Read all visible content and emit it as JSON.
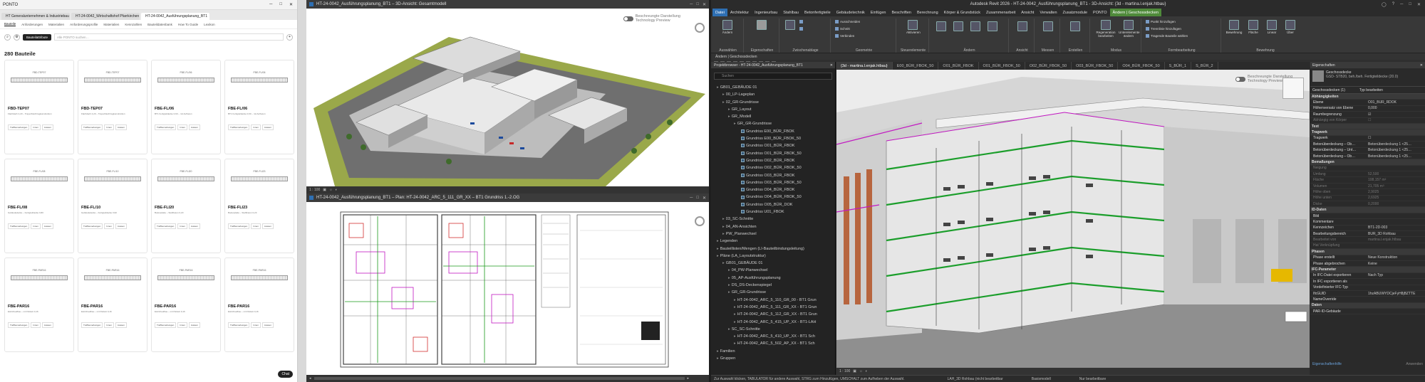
{
  "ponto": {
    "window_title": "PONTO",
    "tabs": [
      "HT Generalunternehmen & Industriebau",
      "HT-24-0042_Wirtschaftshof Pfarrkirchen",
      "HT-24-0042_Ausführungsplanung_BT1"
    ],
    "nav": [
      "Bauteile",
      "Anforderungen",
      "Materialien",
      "Anforderungsprofile",
      "Materialien",
      "Kennzahlen",
      "Bauteildatenbank",
      "How To Guide",
      "Lexikon"
    ],
    "filter_pill": "Bauteilattribute",
    "search_placeholder": "Alle PONTO suchen…",
    "count": "280 Bauteile",
    "chat_button": "Chat",
    "cards": [
      {
        "code": "FBD-TEP07",
        "label": "FBD-TEP07",
        "desc": "Flachdach 4,20 – Trapezblechtragkonstruktion",
        "b1": "Treffbemerkungen",
        "b2": "Innen",
        "b3": "Aussen"
      },
      {
        "code": "FBD-TEP07",
        "label": "FBD-TEP07",
        "desc": "Flachdach 4,20 – Trapezblechtragkonstruktion",
        "b1": "Treffbemerkungen",
        "b2": "Innen",
        "b3": "Aussen"
      },
      {
        "code": "FBE-FL/06",
        "label": "FBE-FL/06",
        "desc": "BT1 Fertigteildecke 0,60 – mit Aufbeton",
        "b1": "Treffbemerkungen",
        "b2": "Innen",
        "b3": "Aussen"
      },
      {
        "code": "FBE-FL/06",
        "label": "FBE-FL/06",
        "desc": "BT1 Fertigteildecke 0,60 – mit Aufbeton",
        "b1": "Treffbemerkungen",
        "b2": "Innen",
        "b3": "Aussen"
      },
      {
        "code": "FBE-FL/08",
        "label": "FBE-FL/08",
        "desc": "Gebäudedecke – Fertigteildecke 0,80",
        "b1": "Treffbemerkungen",
        "b2": "Innen",
        "b3": "Aussen"
      },
      {
        "code": "FBE-FL/10",
        "label": "FBE-FL/10",
        "desc": "Gebäudedecke – Fertigteildecke 0,90",
        "b1": "Treffbemerkungen",
        "b2": "Innen",
        "b3": "Aussen"
      },
      {
        "code": "FBE-FLI20",
        "label": "FBE-FLI20",
        "desc": "Bodenplatte – Stahlbeton 0,20",
        "b1": "Treffbemerkungen",
        "b2": "Innen",
        "b3": "Aussen"
      },
      {
        "code": "FBE-FLI23",
        "label": "FBE-FLI23",
        "desc": "Bodenplatte – Stahlbeton 0,23",
        "b1": "Treffbemerkungen",
        "b2": "Innen",
        "b3": "Aussen"
      },
      {
        "code": "FBE-PAR16",
        "label": "FBE-PAR16",
        "desc": "Estrichaufbau – mit Parkett 0,16",
        "b1": "Treffbemerkungen",
        "b2": "Innen",
        "b3": "Aussen"
      },
      {
        "code": "FBE-PAR16",
        "label": "FBE-PAR16",
        "desc": "Estrichaufbau – mit Parkett 0,16",
        "b1": "Treffbemerkungen",
        "b2": "Innen",
        "b3": "Aussen"
      },
      {
        "code": "FBE-PAR16",
        "label": "FBE-PAR16",
        "desc": "Estrichaufbau – mit Parkett 0,16",
        "b1": "Treffbemerkungen",
        "b2": "Innen",
        "b3": "Aussen"
      },
      {
        "code": "FBE-PAR16",
        "label": "FBE-PAR16",
        "desc": "Estrichaufbau – mit Parkett 0,16",
        "b1": "Treffbemerkungen",
        "b2": "Innen",
        "b3": "Aussen"
      }
    ]
  },
  "revit_left": {
    "view1_title": "HT-24-0042_Ausführungsplanung_BT1 – 3D-Ansicht: Gesamtmodell",
    "view2_title": "HT-24-0042_Ausführungsplanung_BT1 – Plan: HT-24-0042_ARC_5_111_GR_XX – BT1 Grundriss 1.-2.OG",
    "scale": "1 : 100",
    "toggle_label": "Beschreungte Darstellung",
    "toggle_sub": "Technology Preview"
  },
  "revit_right": {
    "app_title": "Autodesk Revit 2026 - HT-24-0042_Ausführungsplanung_BT1 - 3D-Ansicht: {3d - martina.l.enjak.htbau}",
    "menu": [
      "Datei",
      "Architektur",
      "Ingenieurbau",
      "Stahlbau",
      "Betonfertigteile",
      "Gebäudetechnik",
      "Einfügen",
      "Beschriften",
      "Berechnung",
      "Körper & Grundstück",
      "Zusammenarbeit",
      "Ansicht",
      "Verwalten",
      "Zusatzmodule",
      "PONTO",
      "Ändern | Geschossdecken"
    ],
    "ribbon_groups": [
      "Auswählen",
      "Eigenschaften",
      "Zwischenablage",
      "Geometrie",
      "Steuerelemente",
      "Ändern",
      "Ansicht",
      "Messen",
      "Erstellen",
      "Modus",
      "Formbearbeitung",
      "Bewehrung"
    ],
    "ribbon_buttons": {
      "aendern": "Ändern",
      "ausschneiden": "Ausschneiden",
      "verbinden": "Verbinden",
      "schnitt": "Schnitt",
      "aktivieren": "Aktivieren",
      "regeneration": "Regeneration bearbeiten",
      "unterelemente": "Unterelemente ändern",
      "punkt": "Punkt hinzufügen",
      "trennlinie": "Trennlinie hinzufügen",
      "tragende": "Tragende Bauteile wählen",
      "bewehrung": "Bewehrung",
      "flaeche": "Fläche",
      "linear": "Linear",
      "ueber": "Über"
    },
    "context_bar": "Ändern | Geschossdecken",
    "project_browser_title": "Projektbrowser - HT-24-0042_Ausführungsplanung_BT1",
    "browser_search": "Suchen",
    "tree": [
      {
        "t": "GB01_GEBÄUDE 01",
        "i": 1
      },
      {
        "t": "00_LP-Lageplan",
        "i": 2
      },
      {
        "t": "02_GR-Grundrisse",
        "i": 2
      },
      {
        "t": "GR_Layout",
        "i": 3
      },
      {
        "t": "GR_Modell",
        "i": 3
      },
      {
        "t": "GR_GR-Grundrisse",
        "i": 4
      },
      {
        "t": "Grundriss E00_BÜR_FBOK",
        "i": 5,
        "cb": 1
      },
      {
        "t": "Grundriss E00_BÜR_FBOK_50",
        "i": 5,
        "cb": 1
      },
      {
        "t": "Grundriss O01_BÜR_FBOK",
        "i": 5,
        "cb": 1
      },
      {
        "t": "Grundriss O01_BÜR_FBOK_50",
        "i": 5,
        "cb": 1
      },
      {
        "t": "Grundriss O02_BÜR_FBOK",
        "i": 5,
        "cb": 1
      },
      {
        "t": "Grundriss O02_BÜR_FBOK_50",
        "i": 5,
        "cb": 1
      },
      {
        "t": "Grundriss O03_BÜR_FBOK",
        "i": 5,
        "cb": 1
      },
      {
        "t": "Grundriss O03_BÜR_FBOK_50",
        "i": 5,
        "cb": 1
      },
      {
        "t": "Grundriss O04_BÜR_FBOK",
        "i": 5,
        "cb": 1
      },
      {
        "t": "Grundriss O04_BÜR_FBOK_50",
        "i": 5,
        "cb": 1
      },
      {
        "t": "Grundriss O05_BÜR_DOK",
        "i": 5,
        "cb": 1
      },
      {
        "t": "Grundriss U01_FBOK",
        "i": 5,
        "cb": 1
      },
      {
        "t": "03_SC-Schnitte",
        "i": 2
      },
      {
        "t": "04_AN-Ansichten",
        "i": 2
      },
      {
        "t": "PW_Planwechsel",
        "i": 2
      },
      {
        "t": "Legenden",
        "i": 1
      },
      {
        "t": "Bauteillisten/Mengen (LI-Bauteilbindungsleitung)",
        "i": 1
      },
      {
        "t": "Pläne (LA_Layoutstruktur)",
        "i": 1
      },
      {
        "t": "GB01_GEBÄUDE 01",
        "i": 2
      },
      {
        "t": "04_PW-Planwechsel",
        "i": 3
      },
      {
        "t": "05_AP-Ausführungsplanung",
        "i": 3
      },
      {
        "t": "DS_DS-Deckenspiegel",
        "i": 3
      },
      {
        "t": "GR_GR-Grundrisse",
        "i": 3
      },
      {
        "t": "HT-24-0042_ARC_5_110_GR_00 - BT1 Grun",
        "i": 4
      },
      {
        "t": "HT-24-0042_ARC_5_111_GR_XX - BT1 Grun",
        "i": 4
      },
      {
        "t": "HT-24-0042_ARC_5_112_GR_XX - BT1 Grun",
        "i": 4
      },
      {
        "t": "HT-24-0042_ARC_5_415_UP_XX - BT1-LAH",
        "i": 4
      },
      {
        "t": "SC_SC-Schnitte",
        "i": 3
      },
      {
        "t": "HT-24-0042_ARC_5_410_UP_XX - BT1 Sch",
        "i": 4
      },
      {
        "t": "HT-24-0042_ARC_5_502_AP_XX - BT1 Sch",
        "i": 4
      },
      {
        "t": "Familien",
        "i": 1
      },
      {
        "t": "Gruppen",
        "i": 1
      }
    ],
    "view_tabs": [
      "{3d - martina.l.enjak.htbau}",
      "E00_BÜR_FBOK_50",
      "O01_BÜR_FBOK",
      "O01_BÜR_FBOK_50",
      "O02_BÜR_FBOK_50",
      "O03_BÜR_FBOK_50",
      "O04_BÜR_FBOK_50",
      "S_BÜR_1",
      "S_BÜR_2"
    ],
    "properties_title": "Eigenschaften",
    "type_name": "Geschossdecke",
    "type_sub": "GSD- STB20, beh./beh. Fertigteildecke (20.0)",
    "selection": "Geschossdecken (1)",
    "edit_type": "Typ bearbeiten",
    "props": [
      {
        "s": "Abhängigkeiten"
      },
      {
        "k": "Ebene",
        "v": "O01_BÜR_RDOK"
      },
      {
        "k": "Höhenversatz von Ebene",
        "v": "0,000"
      },
      {
        "k": "Raumbegrenzung",
        "v": "☑"
      },
      {
        "k": "Abhängig von Körper",
        "v": "☐",
        "g": 1
      },
      {
        "s": "Text"
      },
      {
        "s": "Tragwerk"
      },
      {
        "k": "Tragwerk",
        "v": "☐"
      },
      {
        "k": "Betonüberdeckung – Ob…",
        "v": "Betonüberdeckung 1 <25…"
      },
      {
        "k": "Betonüberdeckung – Unt…",
        "v": "Betonüberdeckung 1 <25…"
      },
      {
        "k": "Betonüberdeckung – Ob…",
        "v": "Betonüberdeckung 1 <25…"
      },
      {
        "s": "Bemaßungen"
      },
      {
        "k": "Neigung",
        "v": "",
        "g": 1
      },
      {
        "k": "Umfang",
        "v": "52,500",
        "g": 1
      },
      {
        "k": "Fläche",
        "v": "108,157 m²",
        "g": 1
      },
      {
        "k": "Volumen",
        "v": "21,705 m³",
        "g": 1
      },
      {
        "k": "Höhe oben",
        "v": "2,9025",
        "g": 1
      },
      {
        "k": "Höhe unten",
        "v": "2,6925",
        "g": 1
      },
      {
        "k": "Dicke",
        "v": "0,2000",
        "g": 1
      },
      {
        "s": "ID-Daten"
      },
      {
        "k": "Bild",
        "v": ""
      },
      {
        "k": "Kommentare",
        "v": ""
      },
      {
        "k": "Kennzeichen",
        "v": "BT1-2D-003"
      },
      {
        "k": "Bearbeitungsbereich",
        "v": "BÜR_3D Rohbau"
      },
      {
        "k": "Bearbeitet von",
        "v": "martina.l.enjak.htbau",
        "g": 1
      },
      {
        "k": "Hat Verknüpfung",
        "v": "",
        "g": 1
      },
      {
        "s": "Phasen"
      },
      {
        "k": "Phase erstellt",
        "v": "Neue Konstruktion"
      },
      {
        "k": "Phase abgebrochen",
        "v": "Keine"
      },
      {
        "s": "IFC-Parameter"
      },
      {
        "k": "In IFC-Datei exportieren",
        "v": "Nach Typ"
      },
      {
        "k": "In IFC exportieren als",
        "v": ""
      },
      {
        "k": "Vordefinierter IFC-Typ",
        "v": ""
      },
      {
        "k": "IfcGUID",
        "v": "1hzABUWYDCjeFyH8jBZTTE"
      },
      {
        "k": "NameOverride",
        "v": ""
      },
      {
        "s": "Daten"
      },
      {
        "k": "PAR-ID-Gebäude",
        "v": ""
      }
    ],
    "help_link": "Eigenschaftenhilfe",
    "apply": "Anwenden",
    "scale": "1 : 100",
    "status": "Zur Auswahl klicken, TABULATOR für andere Auswahl, STRG zum Hinzufügen, UMSCHALT zum Aufheben der Auswahl.",
    "status_ws": "LAH_3D Rohbau (nicht bearbeitbar",
    "status_model": "Basismodell",
    "status_edit": "Nur bearbeitbare",
    "toggle_label": "Beschreungte Darstellung",
    "toggle_sub": "Technology Preview"
  }
}
